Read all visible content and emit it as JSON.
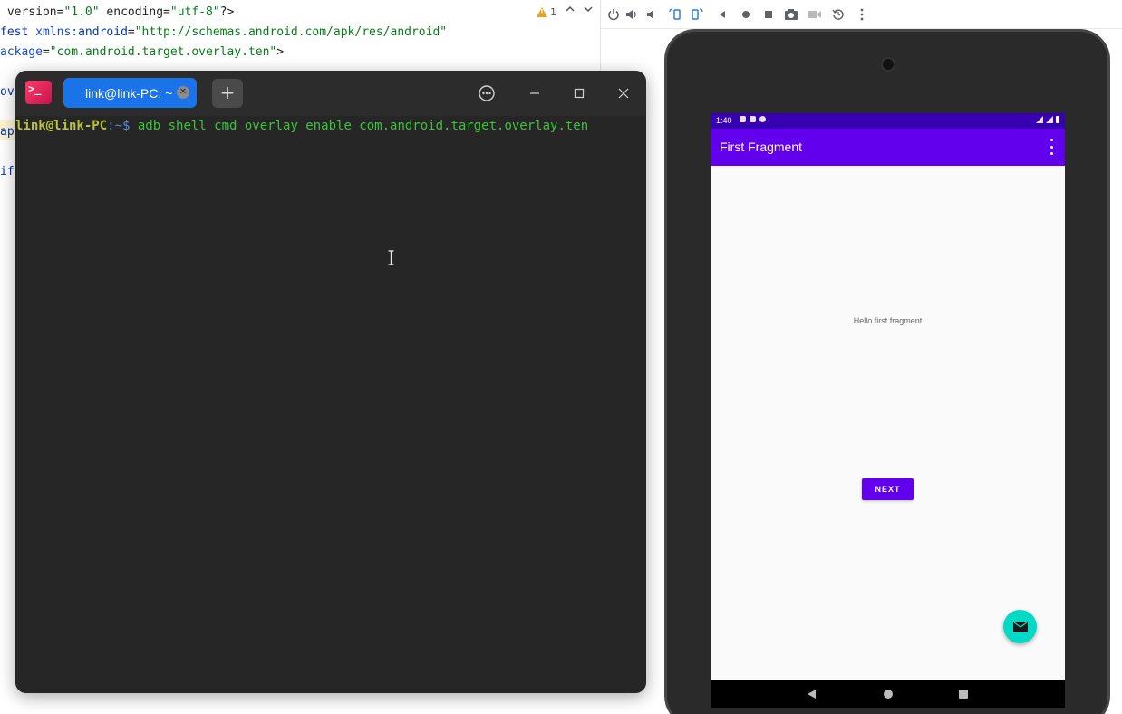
{
  "editor": {
    "lines": [
      {
        "segments": [
          {
            "cls": "plain",
            "text": " version="
          },
          {
            "cls": "str",
            "text": "\"1.0\""
          },
          {
            "cls": "plain",
            "text": " encoding="
          },
          {
            "cls": "str",
            "text": "\"utf-8\""
          },
          {
            "cls": "plain",
            "text": "?>"
          }
        ]
      },
      {
        "segments": [
          {
            "cls": "tag",
            "text": "fest "
          },
          {
            "cls": "attr",
            "text": "xmlns:"
          },
          {
            "cls": "tag",
            "text": "android"
          },
          {
            "cls": "plain",
            "text": "="
          },
          {
            "cls": "str",
            "text": "\"http://schemas.android.com/apk/res/android\""
          }
        ]
      },
      {
        "segments": [
          {
            "cls": "attr",
            "text": "ackage"
          },
          {
            "cls": "plain",
            "text": "="
          },
          {
            "cls": "str",
            "text": "\"com.android.target.overlay.ten\""
          },
          {
            "cls": "plain",
            "text": ">"
          }
        ]
      },
      {
        "segments": [
          {
            "cls": "tag",
            "text": "ov"
          }
        ]
      },
      {
        "segments": [
          {
            "cls": "tag",
            "text": "ap"
          }
        ]
      },
      {
        "segments": [
          {
            "cls": "tag",
            "text": "if"
          }
        ]
      }
    ],
    "warning_count": "1"
  },
  "terminal": {
    "app_icon_glyph": ">_",
    "tab_label": "link@link-PC: ~",
    "tab_close_glyph": "✕",
    "new_tab_glyph": "+",
    "prompt_user": "link@link-PC",
    "prompt_path": ":~",
    "prompt_symbol": "$ ",
    "command": "adb shell cmd overlay enable com.android.target.overlay.ten"
  },
  "emulator": {
    "toolbar_icons": [
      "power-icon",
      "volume-up-icon",
      "volume-down-icon",
      "rotate-left-icon",
      "rotate-right-icon",
      "back-icon",
      "home-icon",
      "overview-icon",
      "screenshot-icon",
      "record-icon",
      "reset-icon",
      "more-icon"
    ],
    "status_time": "1:40",
    "app_title": "First Fragment",
    "hello_text": "Hello first fragment",
    "next_label": "NEXT",
    "colors": {
      "primary": "#6200ee",
      "primary_dark": "#3700b3",
      "accent": "#03dac5"
    }
  }
}
